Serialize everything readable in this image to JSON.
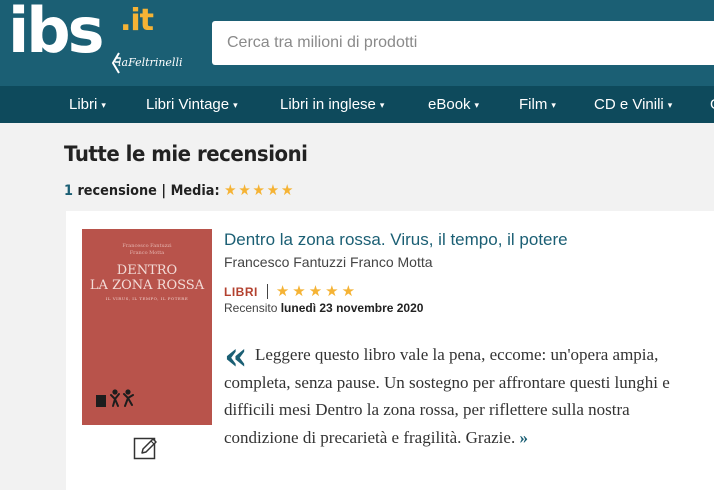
{
  "header": {
    "logo_main": "ibs",
    "logo_tld": ".it",
    "logo_partner": "laFeltrinelli",
    "search_placeholder": "Cerca tra milioni di prodotti"
  },
  "nav": {
    "items": [
      {
        "label": "Libri"
      },
      {
        "label": "Libri Vintage"
      },
      {
        "label": "Libri in inglese"
      },
      {
        "label": "eBook"
      },
      {
        "label": "Film"
      },
      {
        "label": "CD e Vinili"
      },
      {
        "label": "G"
      }
    ],
    "caret": "▾"
  },
  "page": {
    "title": "Tutte le mie recensioni",
    "review_count": "1",
    "review_word": "recensione",
    "separator": "|",
    "media_label": "Media:",
    "average_rating": 5,
    "rating_max": 5,
    "stars": "★★★★★"
  },
  "review": {
    "book_title": "Dentro la zona rossa. Virus, il tempo, il potere",
    "authors": "Francesco Fantuzzi Franco Motta",
    "category": "LIBRI",
    "rating": 5,
    "stars": "★★★★★",
    "reviewed_prefix": "Recensito",
    "reviewed_date": "lunedì 23 novembre 2020",
    "quote_mark": "«",
    "text": "Leggere questo libro vale la pena, eccome: un'opera ampia, completa, senza pause. Un sostegno per affrontare questi lunghi e difficili mesi Dentro la zona rossa, per riflettere sulla nostra condizione di precarietà e fragilità. Grazie.",
    "more_link": "»",
    "cover": {
      "authors_line1": "Francesco Fantuzzi",
      "authors_line2": "Franco Motta",
      "title_line1": "DENTRO",
      "title_line2": "LA ZONA ROSSA",
      "subtitle": "IL VIRUS, IL TEMPO, IL POTERE"
    }
  },
  "colors": {
    "header_bg": "#1b5f74",
    "nav_bg": "#0e4a5c",
    "accent": "#f5b335",
    "link": "#1b5f74",
    "category": "#b3412f",
    "cover": "#b8534b"
  },
  "icons": {
    "edit": "pencil-edit-icon"
  }
}
